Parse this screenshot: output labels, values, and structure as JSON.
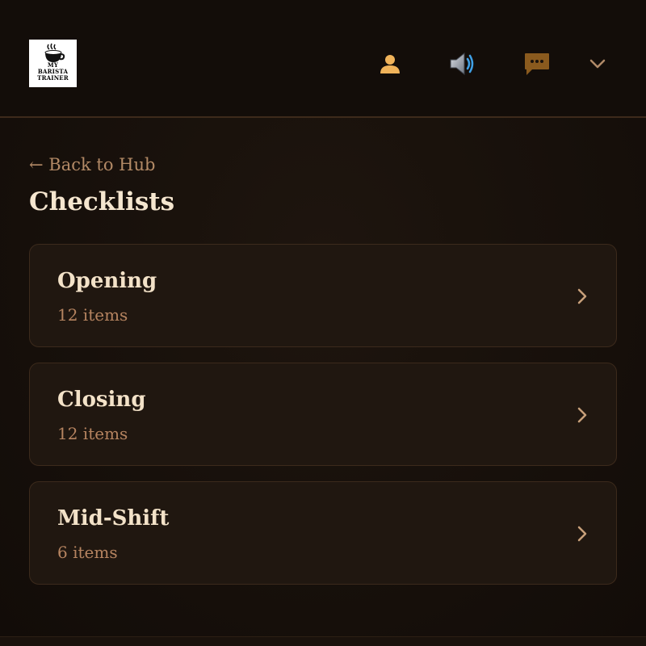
{
  "header": {
    "logo": {
      "line1": "MY",
      "line2": "BARISTA",
      "line3": "TRAINER"
    },
    "icons": {
      "profile": "person-icon",
      "sound": "speaker-icon",
      "chat": "chat-bubble-icon",
      "menu": "chevron-down-icon"
    }
  },
  "nav": {
    "back_label": "← Back to Hub"
  },
  "page": {
    "title": "Checklists"
  },
  "checklists": [
    {
      "title": "Opening",
      "count": "12 items"
    },
    {
      "title": "Closing",
      "count": "12 items"
    },
    {
      "title": "Mid-Shift",
      "count": "6 items"
    }
  ],
  "colors": {
    "accent": "#f0b35a",
    "chat_bubble": "#8a5a1e",
    "card_bg": "#201710",
    "title_text": "#f5e6cf",
    "muted_text": "#b68460"
  }
}
